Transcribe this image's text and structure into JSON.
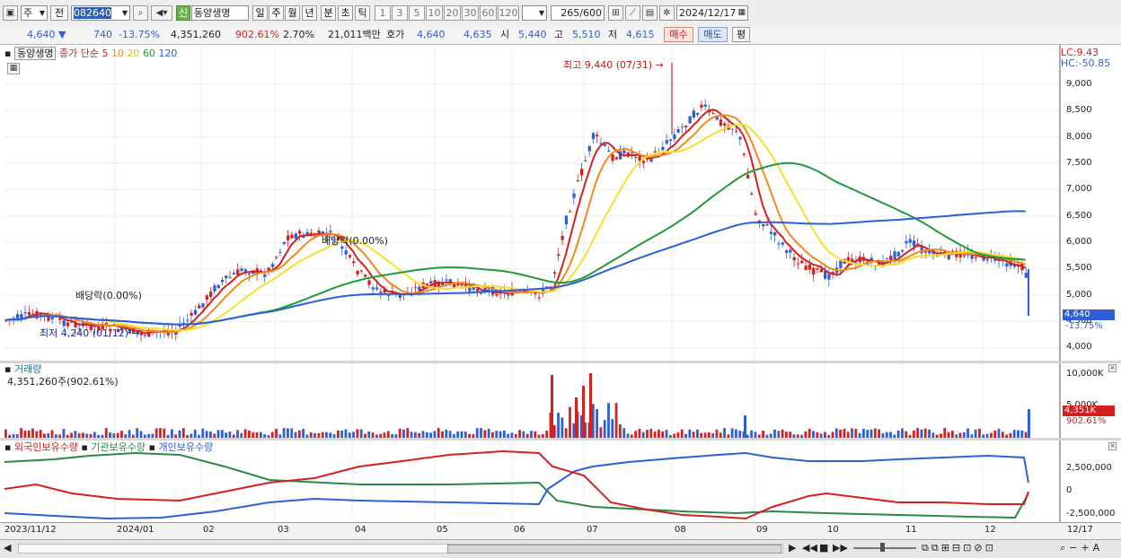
{
  "toolbar": {
    "market_select": "주",
    "prev_label": "전",
    "code_value": "082640",
    "new_badge": "신",
    "stock_name": "동양생명",
    "periods": [
      "일",
      "주",
      "월",
      "년",
      "분",
      "초",
      "틱"
    ],
    "active_period": "일",
    "intervals": [
      "1",
      "3",
      "5",
      "10",
      "20",
      "30",
      "60",
      "120"
    ],
    "count_value": "265",
    "count_total": "/600",
    "date_value": "2024/12/17"
  },
  "quote": {
    "price": "4,640",
    "change": "740",
    "change_pct": "-13.75%",
    "volume": "4,351,260",
    "volume_ratio": "902.61%",
    "turnover_pct": "2.70%",
    "amount": "21,011백만",
    "hoga_label": "호가",
    "ask": "4,640",
    "bid": "4,635",
    "open_label": "시",
    "open": "5,440",
    "high_label": "고",
    "high": "5,510",
    "low_label": "저",
    "low": "4,615",
    "buy_button": "매수",
    "sell_button": "매도",
    "eval_button": "평"
  },
  "price_panel": {
    "stock_label": "동양생명",
    "ma_title": "종가 단순",
    "ma_periods": [
      "5",
      "10",
      "20",
      "60",
      "120"
    ],
    "lc_label": "LC:9.43",
    "hc_label": "HC:-50.85",
    "annotation_high": "최고 9,440 (07/31) →",
    "annotation_low": "최저 4,240 (01/12) →",
    "dividend_1": "배당락(0.00%)",
    "dividend_2": "배당락(0.00%)",
    "y_ticks": [
      "9,000",
      "8,500",
      "8,000",
      "7,500",
      "7,000",
      "6,500",
      "6,000",
      "5,500",
      "5,000",
      "4,500",
      "4,000"
    ],
    "current_price_box": "4,640",
    "current_change_box": "-13.75%"
  },
  "volume_panel": {
    "title": "거래량",
    "value_label": "4,351,260주(902.61%)",
    "y_ticks": [
      "10,000K",
      "5,000K"
    ],
    "current_box": "4,351K",
    "current_ratio": "902.61%"
  },
  "holding_panel": {
    "legend": [
      "외국인보유수량",
      "기관보유수량",
      "개인보유수량"
    ],
    "y_ticks": [
      "2,500,000",
      "0",
      "-2,500,000"
    ]
  },
  "x_axis": {
    "labels": [
      "2023/11/12",
      "2024/01",
      "02",
      "03",
      "04",
      "05",
      "06",
      "07",
      "08",
      "09",
      "10",
      "11",
      "12"
    ],
    "end_label": "12/17"
  },
  "colors": {
    "ma5": "#d42020",
    "ma10": "#f08a1c",
    "ma20": "#f5e030",
    "ma60": "#1f9a3a",
    "ma120": "#2d5fd6",
    "up_candle": "#d42020",
    "down_candle": "#2d5fd6",
    "foreign": "#d42020",
    "institution": "#2a8a4a",
    "individual": "#2d5fd6"
  }
}
